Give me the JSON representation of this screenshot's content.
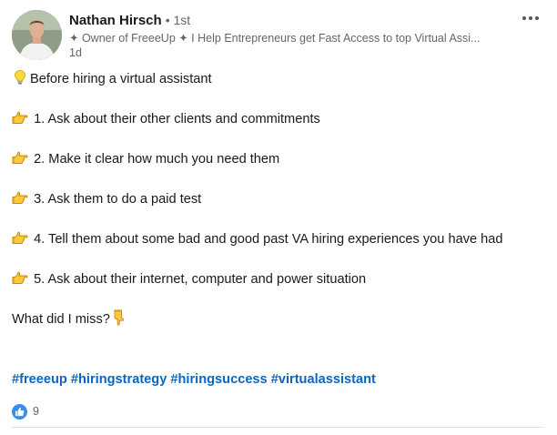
{
  "author": {
    "name": "Nathan Hirsch",
    "degree": "• 1st",
    "headline": "✦ Owner of FreeeUp ✦ I Help Entrepreneurs get Fast Access to top Virtual Assi...",
    "time": "1d"
  },
  "post": {
    "intro": "Before hiring a virtual assistant",
    "tips": [
      "1. Ask about their other clients and commitments",
      "2. Make it clear how much you need them",
      "3. Ask them to do a paid test",
      "4. Tell them about some bad and good past VA hiring experiences you have had",
      "5. Ask about their internet, computer and power situation"
    ],
    "closing": "What did I miss?",
    "hashtags": [
      "#freeeup",
      "#hiringstrategy",
      "#hiringsuccess",
      "#virtualassistant"
    ]
  },
  "reactions": {
    "icon": "like-icon",
    "count": "9",
    "color": "#378fe9"
  },
  "colors": {
    "hashtag": "#0a66c2",
    "secondary_text": "#666666"
  }
}
